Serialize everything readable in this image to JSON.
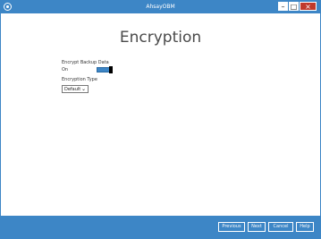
{
  "window": {
    "title": "AhsayOBM",
    "controls": {
      "minimize": "–",
      "maximize": "□",
      "close": "×"
    }
  },
  "page": {
    "heading": "Encryption"
  },
  "form": {
    "encrypt_backup_label": "Encrypt Backup Data",
    "encrypt_backup_value": "On",
    "encryption_type_label": "Encryption Type",
    "encryption_type_value": "Default",
    "select_indicator": "⌄"
  },
  "footer": {
    "previous": "Previous",
    "next": "Next",
    "cancel": "Cancel",
    "help": "Help"
  },
  "colors": {
    "accent": "#3d86c6",
    "close": "#c0392b"
  },
  "icons": {
    "app": "ahsay-app-icon",
    "chevron": "chevron-down-icon"
  }
}
